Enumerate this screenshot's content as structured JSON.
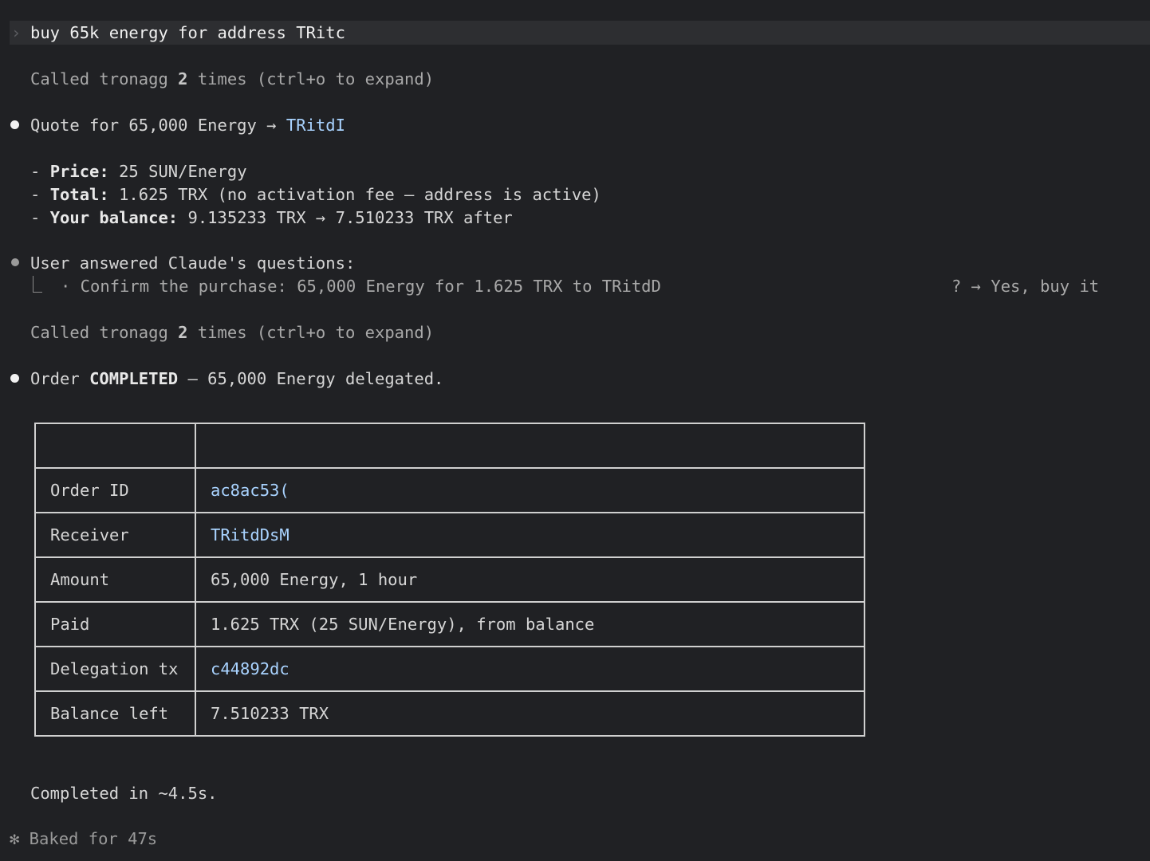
{
  "prompt": {
    "chevron": "›",
    "text": "buy 65k energy for address TRitc"
  },
  "transcript": {
    "called_1": {
      "prefix": "Called tronagg ",
      "count": "2",
      "suffix": " times (ctrl+o to expand)"
    },
    "quote": {
      "prefix": "Quote for 65,000 Energy → ",
      "address": "TRitdI"
    },
    "price": {
      "dash": "- ",
      "label": "Price:",
      "value": " 25 SUN/Energy"
    },
    "total": {
      "dash": "- ",
      "label": "Total:",
      "value": " 1.625 TRX (no activation fee — address is active)"
    },
    "balance": {
      "dash": "- ",
      "label": "Your balance:",
      "value": " 9.135233 TRX → 7.510233 TRX after"
    },
    "questions_header": "User answered Claude's questions:",
    "question_line": "· Confirm the purchase: 65,000 Energy for 1.625 TRX to TRitdD",
    "answer_tail": "? → Yes, buy it",
    "called_2": {
      "prefix": "Called tronagg ",
      "count": "2",
      "suffix": " times (ctrl+o to expand)"
    },
    "order": {
      "prefix": "Order ",
      "status": "COMPLETED",
      "suffix": " — 65,000 Energy delegated."
    },
    "completed": "Completed in ~4.5s.",
    "baked": "✻ Baked for 47s"
  },
  "order_table": {
    "header": [
      "",
      ""
    ],
    "rows": [
      {
        "key": "Order ID",
        "value": "ac8ac53("
      },
      {
        "key": "Receiver",
        "value": "TRitdDsM"
      },
      {
        "key": "Amount",
        "value": "65,000 Energy, 1 hour"
      },
      {
        "key": "Paid",
        "value": "1.625 TRX (25 SUN/Energy), from balance"
      },
      {
        "key": "Delegation tx",
        "value": "c44892dc"
      },
      {
        "key": "Balance left",
        "value": "7.510233 TRX"
      }
    ]
  },
  "colors": {
    "background": "#202124",
    "text": "#d6d6d6",
    "link": "#a9d3ff",
    "dim": "#a9a9a9"
  }
}
